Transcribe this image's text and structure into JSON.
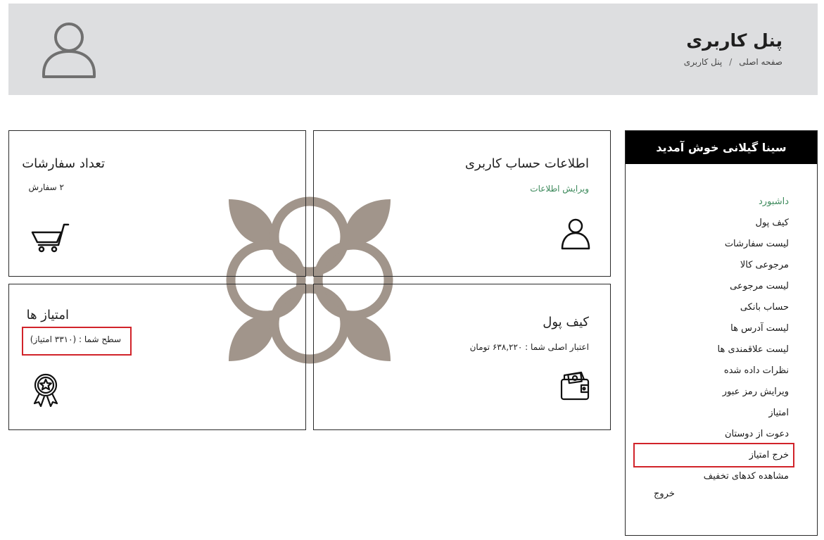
{
  "header": {
    "title": "پنل کاربری",
    "breadcrumb": {
      "home": "صفحه اصلی",
      "separator": "/",
      "current": "پنل کاربری"
    }
  },
  "cards": {
    "account": {
      "title": "اطلاعات حساب کاربری",
      "link": "ویرایش اطلاعات",
      "icon": "user-icon"
    },
    "orders": {
      "title": "تعداد سفارشات",
      "subtitle": "۲ سفارش",
      "icon": "cart-icon"
    },
    "wallet": {
      "title": "کیف پول",
      "subtitle": "اعتبار اصلی شما : ۶۳۸,۲۲۰ تومان",
      "icon": "wallet-icon"
    },
    "points": {
      "title": "امتیاز ها",
      "subtitle": "سطح شما : (۳۳۱۰ امتیاز)",
      "icon": "badge-icon"
    }
  },
  "sidebar": {
    "welcome": "سینا گیلانی خوش آمدید",
    "items": [
      {
        "label": "داشبورد"
      },
      {
        "label": "کیف پول"
      },
      {
        "label": "لیست سفارشات"
      },
      {
        "label": "مرجوعی کالا"
      },
      {
        "label": "لیست مرجوعی"
      },
      {
        "label": "حساب بانکی"
      },
      {
        "label": "لیست آدرس ها"
      },
      {
        "label": "لیست علاقمندی ها"
      },
      {
        "label": "نظرات داده شده"
      },
      {
        "label": "ویرایش رمز عبور"
      },
      {
        "label": "امتیاز"
      },
      {
        "label": "دعوت از دوستان"
      },
      {
        "label": "خرج امتیاز"
      },
      {
        "label": "مشاهده کدهای تخفیف"
      }
    ],
    "logout": "خروج"
  },
  "colors": {
    "accent": "#3d8a5c",
    "highlight": "#d1232a",
    "header_bg": "#dddee0",
    "watermark": "#a1958b"
  }
}
